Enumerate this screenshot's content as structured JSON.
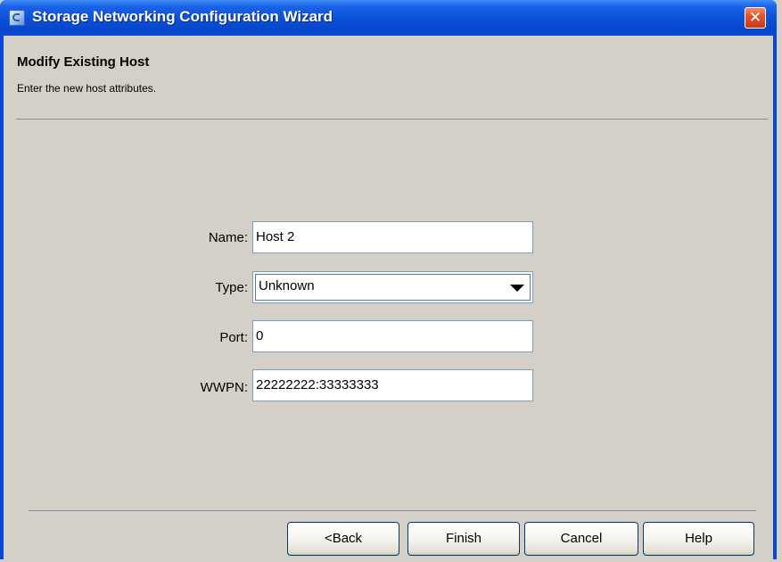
{
  "window": {
    "title": "Storage Networking Configuration Wizard",
    "close_glyph": "✕"
  },
  "header": {
    "title": "Modify Existing Host",
    "subtitle": "Enter the new host attributes."
  },
  "form": {
    "name": {
      "label": "Name:",
      "value": "Host 2"
    },
    "type": {
      "label": "Type:",
      "value": "Unknown"
    },
    "port": {
      "label": "Port:",
      "value": "0"
    },
    "wwpn": {
      "label": "WWPN:",
      "value": "22222222:33333333"
    }
  },
  "buttons": {
    "back": "<Back",
    "finish": "Finish",
    "cancel": "Cancel",
    "help": "Help"
  },
  "colors": {
    "title_bar": "#0a4fd8",
    "close_button": "#e0552e",
    "dialog_background": "#d4d0c8",
    "separator": "#8c87a8",
    "field_border": "#7f9db9"
  },
  "icons": {
    "app": "app-icon",
    "close": "close-icon",
    "dropdown": "chevron-down-icon"
  }
}
